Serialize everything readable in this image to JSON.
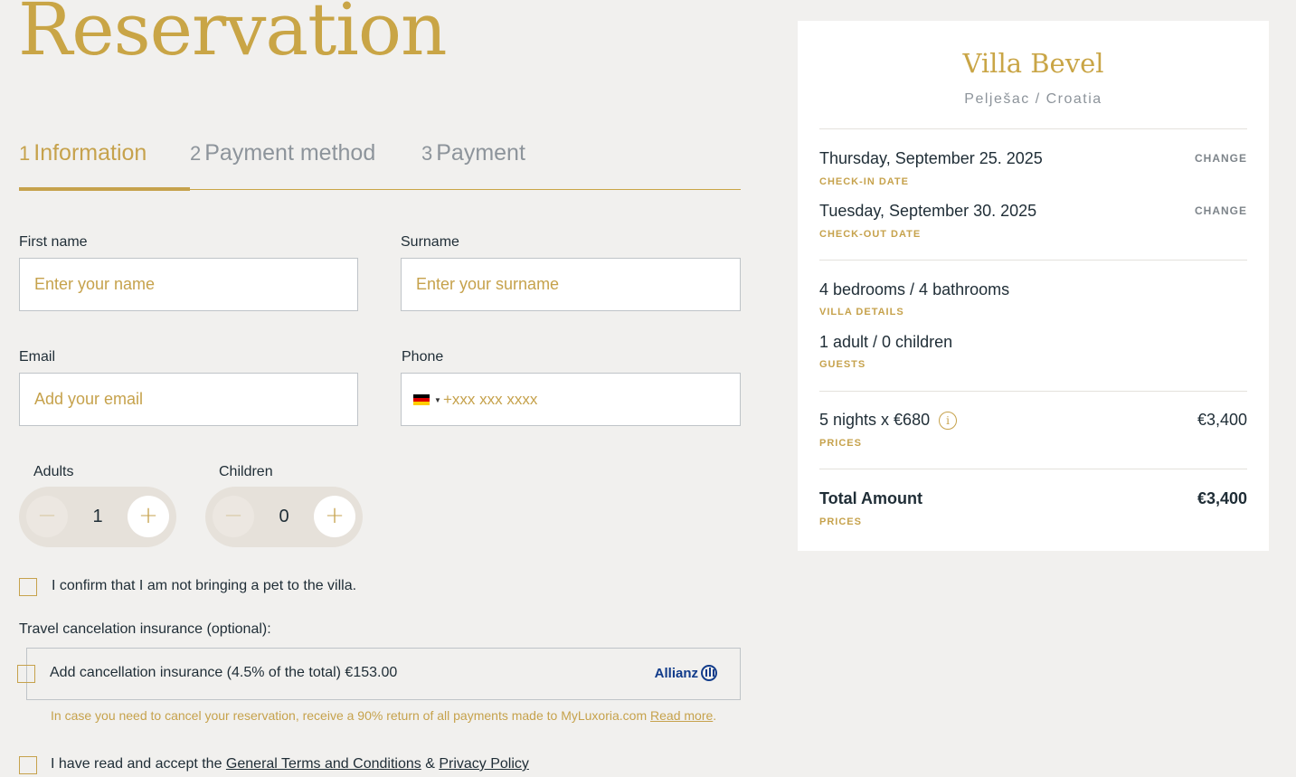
{
  "page": {
    "title": "Reservation"
  },
  "steps": [
    {
      "num": "1",
      "label": "Information",
      "active": true
    },
    {
      "num": "2",
      "label": "Payment method",
      "active": false
    },
    {
      "num": "3",
      "label": "Payment",
      "active": false
    }
  ],
  "form": {
    "first_name": {
      "label": "First name",
      "placeholder": "Enter your name"
    },
    "surname": {
      "label": "Surname",
      "placeholder": "Enter your surname"
    },
    "email": {
      "label": "Email",
      "placeholder": "Add your email"
    },
    "phone": {
      "label": "Phone",
      "placeholder": "+xxx xxx xxxx",
      "flag": "germany-flag-icon"
    },
    "adults": {
      "label": "Adults",
      "value": "1"
    },
    "children": {
      "label": "Children",
      "value": "0"
    },
    "stepper_minus": "−",
    "stepper_plus": "+",
    "pet_confirm": "I confirm that I am not bringing a pet to the villa.",
    "insurance_heading": "Travel cancelation insurance (optional):",
    "insurance_label": "Add cancellation insurance (4.5% of the total) €153.00",
    "insurance_brand": "Allianz",
    "insurance_note": "In case you need to cancel your reservation, receive a 90% return of all payments made to MyLuxoria.com",
    "insurance_read_more": "Read more",
    "insurance_note_end": ".",
    "terms_prefix": "I have read and accept the",
    "terms_link": "General Terms and Conditions",
    "terms_amp": "&",
    "privacy_link": "Privacy Policy"
  },
  "summary": {
    "villa_name": "Villa Bevel",
    "location": "Pelješac / Croatia",
    "checkin": {
      "value": "Thursday, September 25. 2025",
      "label": "CHECK-IN DATE",
      "action": "CHANGE"
    },
    "checkout": {
      "value": "Tuesday, September 30. 2025",
      "label": "CHECK-OUT DATE",
      "action": "CHANGE"
    },
    "villa_details": {
      "value": "4 bedrooms / 4 bathrooms",
      "label": "VILLA DETAILS"
    },
    "guests": {
      "value": "1 adult / 0 children",
      "label": "GUESTS"
    },
    "nights": {
      "value": "5 nights x €680",
      "label": "PRICES",
      "amount": "€3,400",
      "info_icon": "i"
    },
    "total": {
      "value": "Total Amount",
      "label": "PRICES",
      "amount": "€3,400"
    }
  },
  "colors": {
    "accent": "#c6a24c",
    "background": "#f1f0ee",
    "text": "#1f2d36"
  }
}
